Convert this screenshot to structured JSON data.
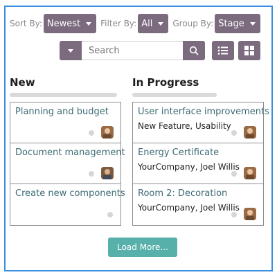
{
  "filters": {
    "sort_label": "Sort By:",
    "sort_value": "Newest",
    "filter_label": "Filter By:",
    "filter_value": "All",
    "group_label": "Group By:",
    "group_value": "Stage"
  },
  "search": {
    "placeholder": "Search"
  },
  "view_buttons": [
    "list-view",
    "grid-view"
  ],
  "colors": {
    "accent": "#7c6a7f",
    "card_title": "#3d6b75",
    "load_more": "#58b0ab",
    "frame": "#3b8fe0"
  },
  "columns": [
    {
      "title": "New",
      "cards": [
        {
          "title": "Planning and budget",
          "subtitle": ""
        },
        {
          "title": "Document management",
          "subtitle": ""
        },
        {
          "title": "Create new components",
          "subtitle": ""
        }
      ]
    },
    {
      "title": "In Progress",
      "cards": [
        {
          "title": "User interface improvements",
          "subtitle": "New Feature, Usability"
        },
        {
          "title": "Energy Certificate",
          "subtitle": "YourCompany, Joel Willis"
        },
        {
          "title": "Room 2: Decoration",
          "subtitle": "YourCompany, Joel Willis"
        }
      ]
    }
  ],
  "load_more_label": "Load More..."
}
